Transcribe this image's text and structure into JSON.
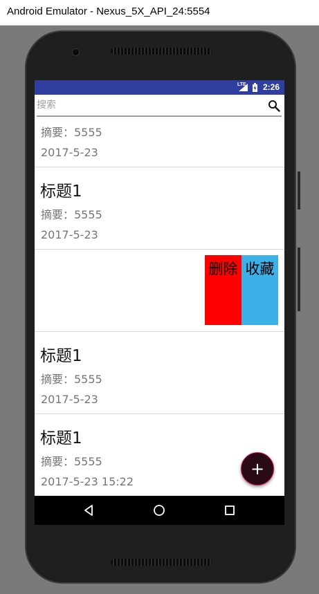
{
  "window": {
    "title": "Android Emulator - Nexus_5X_API_24:5554"
  },
  "status_bar": {
    "network": "LTE",
    "time": "2:26"
  },
  "search": {
    "placeholder": "搜索",
    "value": ""
  },
  "list": {
    "rows": [
      {
        "summary": "摘要：5555",
        "date": "2017-5-23"
      },
      {
        "title": "标题1",
        "summary": "摘要：5555",
        "date": "2017-5-23"
      },
      {
        "actions": {
          "delete_label": "删除",
          "favorite_label": "收藏"
        }
      },
      {
        "title": "标题1",
        "summary": "摘要：5555",
        "date": "2017-5-23"
      },
      {
        "title": "标题1",
        "summary": "摘要：5555",
        "date": "2017-5-23 15:22"
      }
    ]
  },
  "fab": {
    "label": "+"
  },
  "nav_bar": {
    "icons": [
      "back-icon",
      "home-icon",
      "recents-icon"
    ]
  },
  "colors": {
    "status_bar": "#303f9f",
    "delete_button": "#ff0000",
    "favorite_button": "#3bb1e8",
    "fab": "#2a0a14"
  }
}
